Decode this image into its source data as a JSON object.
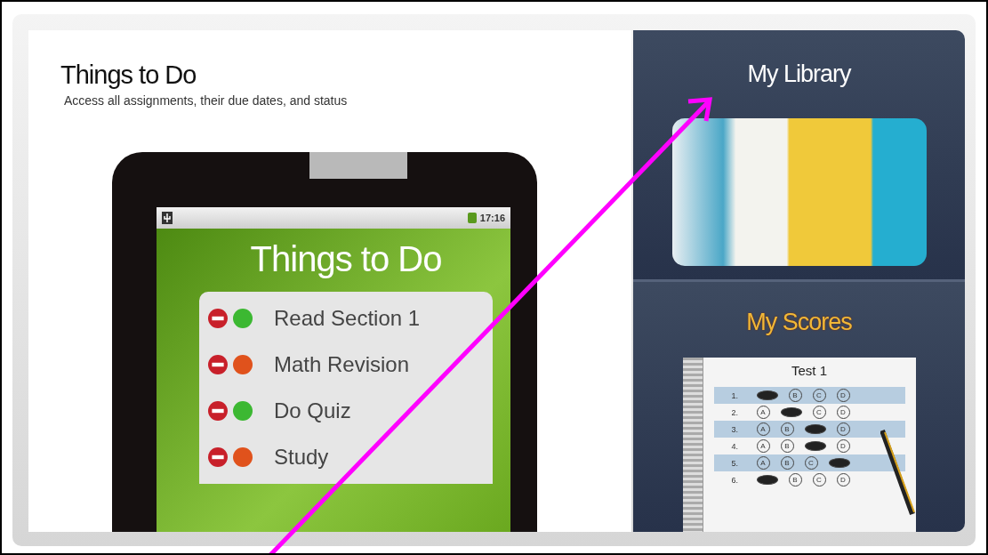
{
  "left_panel": {
    "title": "Things to Do",
    "subtitle": "Access all assignments, their due dates, and status",
    "tablet": {
      "time": "17:16",
      "screen_title": "Things to Do",
      "items": [
        {
          "label": "Read Section 1",
          "color": "#3cb832"
        },
        {
          "label": "Math Revision",
          "color": "#e0521c"
        },
        {
          "label": "Do Quiz",
          "color": "#3cb832"
        },
        {
          "label": "Study",
          "color": "#e0521c"
        }
      ]
    }
  },
  "right_panel": {
    "library": {
      "title": "My Library"
    },
    "scores": {
      "title": "My Scores",
      "sheet": {
        "title": "Test 1",
        "rows": [
          {
            "number": "1.",
            "options": [
              {
                "filled": true
              },
              {
                "letter": "B",
                "filled": false
              },
              {
                "letter": "C",
                "filled": false
              },
              {
                "letter": "D",
                "filled": false
              }
            ]
          },
          {
            "number": "2.",
            "options": [
              {
                "letter": "A",
                "filled": false
              },
              {
                "filled": true
              },
              {
                "letter": "C",
                "filled": false
              },
              {
                "letter": "D",
                "filled": false
              }
            ]
          },
          {
            "number": "3.",
            "options": [
              {
                "letter": "A",
                "filled": false
              },
              {
                "letter": "B",
                "filled": false
              },
              {
                "filled": true
              },
              {
                "letter": "D",
                "filled": false
              }
            ]
          },
          {
            "number": "4.",
            "options": [
              {
                "letter": "A",
                "filled": false
              },
              {
                "letter": "B",
                "filled": false
              },
              {
                "filled": true
              },
              {
                "letter": "D",
                "filled": false
              }
            ]
          },
          {
            "number": "5.",
            "options": [
              {
                "letter": "A",
                "filled": false
              },
              {
                "letter": "B",
                "filled": false
              },
              {
                "letter": "C",
                "filled": false
              },
              {
                "filled": true
              }
            ]
          },
          {
            "number": "6.",
            "options": [
              {
                "filled": true
              },
              {
                "letter": "B",
                "filled": false
              },
              {
                "letter": "C",
                "filled": false
              },
              {
                "letter": "D",
                "filled": false
              }
            ]
          }
        ]
      }
    }
  }
}
